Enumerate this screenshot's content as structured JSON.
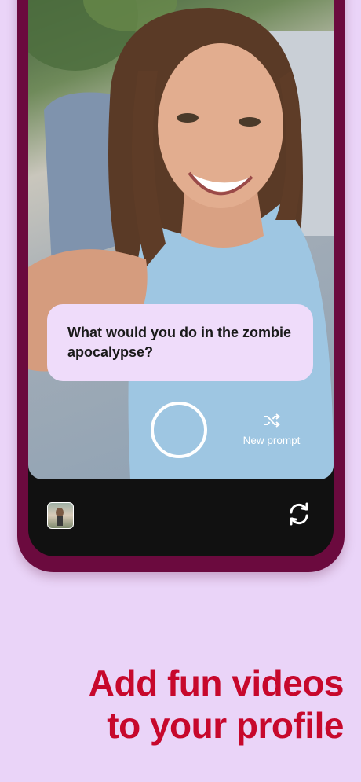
{
  "prompt": {
    "question": "What would you do in the zombie apocalypse?"
  },
  "controls": {
    "new_prompt_label": "New prompt",
    "record_icon": "record-circle-icon",
    "shuffle_icon": "shuffle-icon",
    "flip_icon": "flip-camera-icon"
  },
  "headline": {
    "line1": "Add fun videos",
    "line2": "to your profile"
  },
  "colors": {
    "background": "#ead4f8",
    "phone_frame": "#6b0a3e",
    "headline": "#c7082c",
    "prompt_card": "#efdcfa"
  }
}
